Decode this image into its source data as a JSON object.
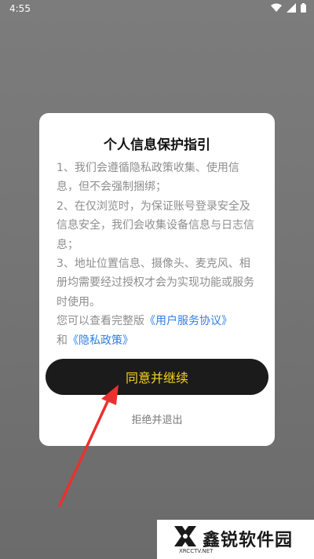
{
  "status_bar": {
    "time": "4:55"
  },
  "dialog": {
    "title": "个人信息保护指引",
    "paragraphs": [
      "1、我们会遵循隐私政策收集、使用信息，但不会强制捆绑；",
      "2、在仅浏览时，为保证账号登录安全及信息安全，我们会收集设备信息与日志信息；",
      "3、地址位置信息、摄像头、麦克风、相册均需要经过授权才会为实现功能或服务时使用。"
    ],
    "links_prefix": "您可以查看完整版",
    "user_agreement_link": "《用户服务协议》",
    "links_joiner": "和",
    "privacy_policy_link": "《隐私政策》",
    "agree_button": "同意并继续",
    "decline_button": "拒绝并退出"
  },
  "watermark": {
    "name": "鑫锐软件园",
    "url": "XRCCTV.NET"
  },
  "colors": {
    "overlay": "#757575",
    "agree_button_bg": "#1b1b1b",
    "agree_button_text": "#f5d426",
    "link": "#2f7fe6",
    "annotation_arrow": "#e8322f"
  }
}
